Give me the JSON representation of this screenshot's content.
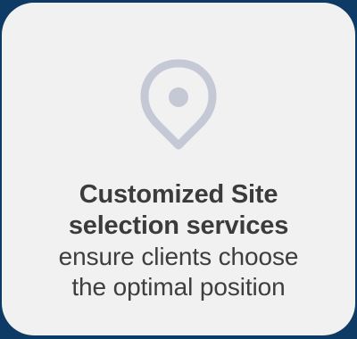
{
  "card": {
    "title_lines": [
      "Customized Site",
      "selection services"
    ],
    "description_lines": [
      "ensure clients choose",
      "the optimal position"
    ],
    "icon": "location-pin-icon"
  },
  "colors": {
    "background": "#0e3a66",
    "card": "#f1f1f2",
    "icon": "#c5c9d6",
    "text": "#3b3b3b"
  }
}
